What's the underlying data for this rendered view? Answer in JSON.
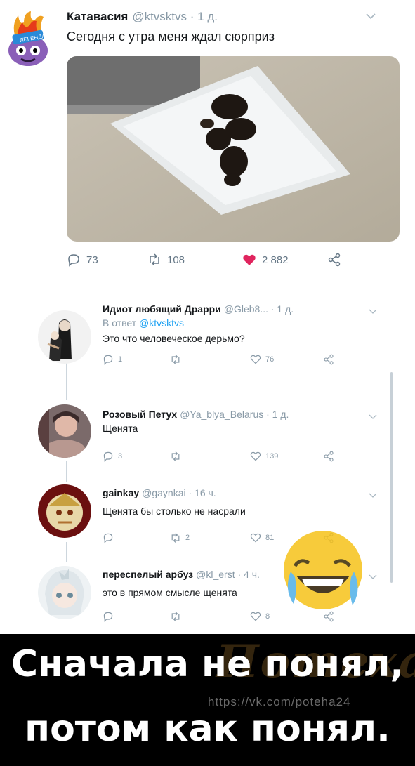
{
  "tweet": {
    "author_name": "Катавасия",
    "author_meta": "@ktvsktvs · 1 д.",
    "text": "Сегодня с утра меня ждал сюрприз",
    "actions": {
      "replies": "73",
      "retweets": "108",
      "likes": "2 882"
    },
    "colors": {
      "like": "#e0245e",
      "meta": "#8899a6",
      "link": "#1da1f2"
    }
  },
  "replies": [
    {
      "name": "Идиот любящий Драрри",
      "meta": "@Gleb8... · 1 д.",
      "reply_to_prefix": "В ответ ",
      "reply_to_handle": "@ktvsktvs",
      "text": "Это что человеческое дерьмо?",
      "replies": "1",
      "retweets": "",
      "likes": "76"
    },
    {
      "name": "Розовый Петух",
      "meta": "@Ya_blya_Belarus · 1 д.",
      "text": "Щенята",
      "replies": "3",
      "retweets": "",
      "likes": "139"
    },
    {
      "name": "gainkay",
      "meta": "@gaynkai · 16 ч.",
      "text": "Щенята бы столько не насрали",
      "replies": "",
      "retweets": "2",
      "likes": "81"
    },
    {
      "name": "переспелый арбуз",
      "meta": "@kl_erst · 4 ч.",
      "text": "это в прямом смысле щенята",
      "replies": "",
      "retweets": "",
      "likes": "8"
    }
  ],
  "watermark": {
    "logo": "Потеха",
    "url": "https://vk.com/poteha24"
  },
  "caption": {
    "line1": "Сначала не понял,",
    "line2": "потом как понял."
  },
  "icons": [
    "chevron-down-icon",
    "reply-icon",
    "retweet-icon",
    "like-icon",
    "share-icon",
    "laughing-emoji-icon"
  ]
}
